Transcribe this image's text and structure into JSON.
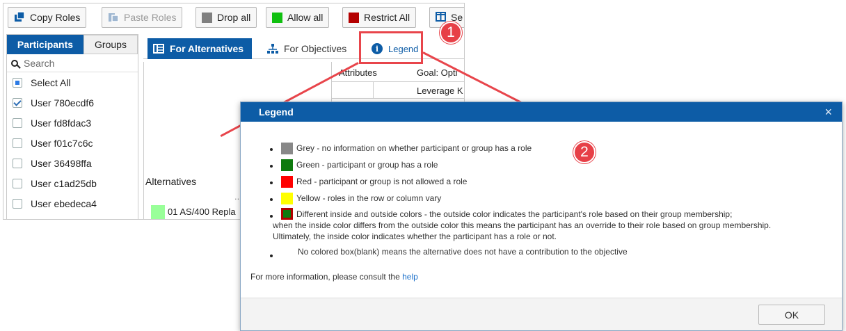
{
  "toolbar": {
    "copy_roles": "Copy Roles",
    "paste_roles": "Paste Roles",
    "drop_all": "Drop all",
    "allow_all": "Allow all",
    "restrict_all": "Restrict All",
    "se": "Se"
  },
  "sidebar": {
    "tabs": [
      "Participants",
      "Groups"
    ],
    "search_placeholder": "Search",
    "select_all": "Select All",
    "users": [
      "User 780ecdf6",
      "User fd8fdac3",
      "User f01c7c6c",
      "User 36498ffa",
      "User c1ad25db",
      "User ebedeca4"
    ]
  },
  "main": {
    "tabs": {
      "alternatives": "For Alternatives",
      "objectives": "For Objectives",
      "legend": "Legend"
    },
    "grid": {
      "attributes": "Attributes",
      "goal": "Goal: Opti",
      "leverage": "Leverage K",
      "alternatives": "Alternatives",
      "ellipsis": "...",
      "row1": "01 AS/400 Repla"
    }
  },
  "callouts": [
    "1",
    "2"
  ],
  "dialog": {
    "title": "Legend",
    "close": "×",
    "items": [
      "Grey - no information on whether participant or group has a role",
      "Green - participant or group has a role",
      "Red - participant or group is not allowed a role",
      "Yellow - roles in the row or column vary"
    ],
    "different_colors": [
      "Different inside and outside colors - the outside color indicates the participant's role based on their group membership;",
      "when the inside color differs from the outside color this means the participant has an override to their role based on group membership.",
      "Ultimately, the inside color indicates whether the participant has a role or not."
    ],
    "blank": "No colored box(blank) means the alternative does not have a contribution to the objective",
    "help_prefix": "For more information, please consult the",
    "help_link": "help",
    "ok": "OK"
  },
  "colors": {
    "grey": "#888888",
    "green": "#0e7a0e",
    "red": "#ff0000",
    "yellow": "#ffff00",
    "accent": "#0d5ca6",
    "callout": "#e8454b",
    "alt_row": "#99ff99"
  }
}
